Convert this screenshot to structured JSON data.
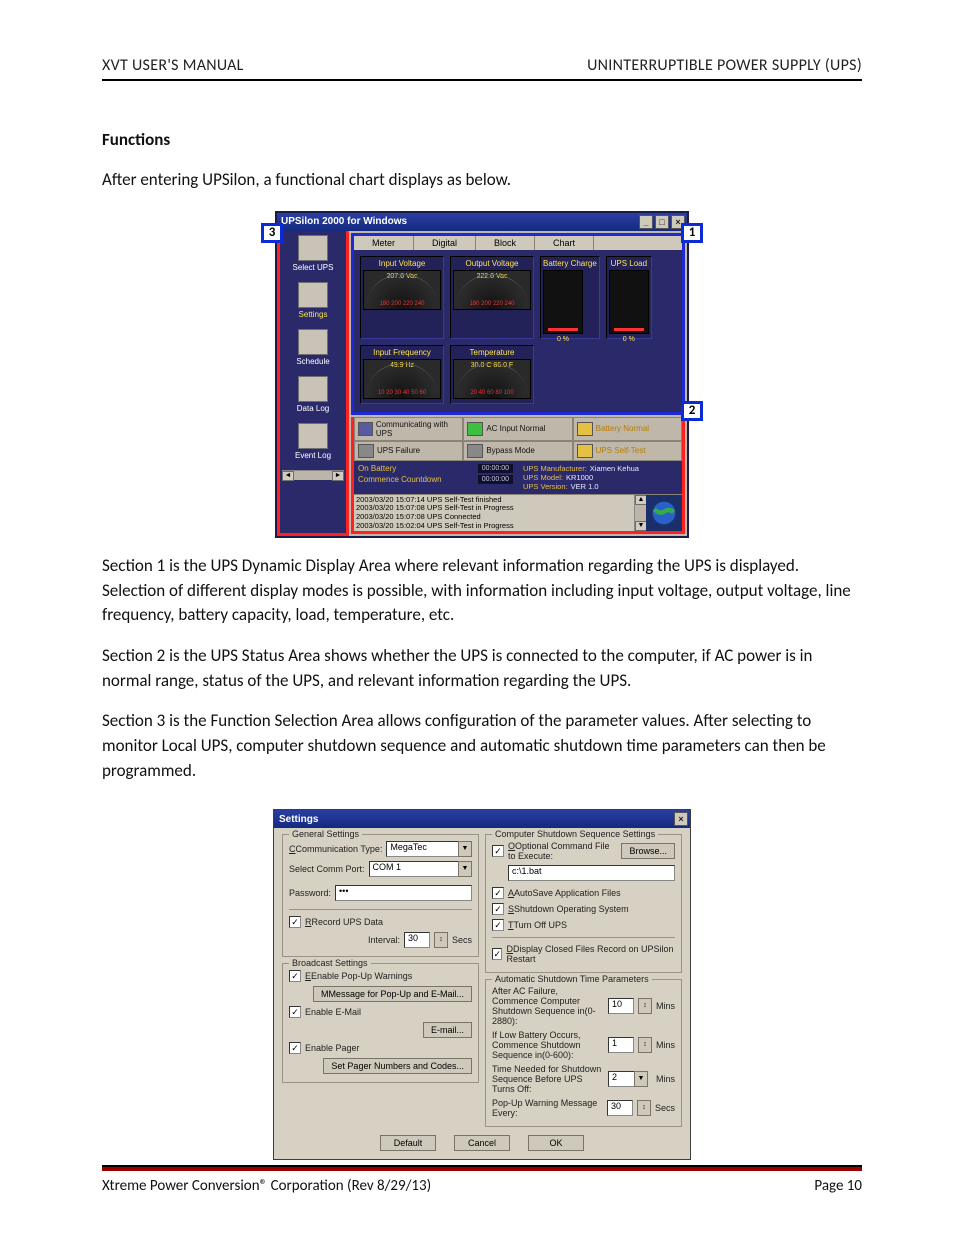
{
  "header": {
    "left": "XVT USER'S MANUAL",
    "right": "UNINTERRUPTIBLE POWER SUPPLY (UPS)"
  },
  "section_title": "Functions",
  "paras": {
    "p0": "After entering UPSilon, a functional chart displays as below.",
    "p1": "Section 1 is the UPS Dynamic Display Area where relevant information regarding the UPS is displayed. Selection of different display modes is possible, with information including input voltage, output voltage, line frequency, battery capacity, load, temperature, etc.",
    "p2": "Section 2 is the UPS Status Area shows whether the UPS is connected to the computer, if AC power is in normal range, status of the UPS, and relevant information regarding the UPS.",
    "p3": "Section 3 is the Function Selection Area allows configuration of the parameter values.  After selecting to monitor Local UPS, computer shutdown sequence and automatic shutdown time parameters can then be programmed."
  },
  "tags": {
    "t1": "1",
    "t2": "2",
    "t3": "3"
  },
  "upsilon": {
    "title": "UPSilon 2000 for Windows",
    "winbtns": {
      "min": "_",
      "max": "□",
      "close": "×"
    },
    "sidebar": {
      "items": [
        {
          "label": "Select UPS",
          "hi": false
        },
        {
          "label": "Settings",
          "hi": true
        },
        {
          "label": "Schedule",
          "hi": false
        },
        {
          "label": "Data Log",
          "hi": false
        },
        {
          "label": "Event Log",
          "hi": false
        }
      ],
      "arrows": {
        "left": "◄",
        "right": "►"
      }
    },
    "tabs": [
      "Meter",
      "Digital",
      "Block",
      "Chart"
    ],
    "panels": {
      "ivolt": {
        "t": "Input Voltage",
        "v": "207.6 Vac",
        "ticks": "180 200 220 240"
      },
      "ovolt": {
        "t": "Output Voltage",
        "v": "222.6 Vac",
        "ticks": "180 200 220 240"
      },
      "batt": {
        "t": "Battery Charge",
        "pct": "0 %"
      },
      "load": {
        "t": "UPS Load",
        "pct": "0 %"
      },
      "ifreq": {
        "t": "Input Frequency",
        "v": "49.9 Hz",
        "ticks": "10 20 30 40 50 60"
      },
      "temp": {
        "t": "Temperature",
        "v": "30.0 C   86.0 F",
        "ticks": "20 40 60 80 100"
      }
    },
    "status": {
      "r1": [
        {
          "t": "Communicating with UPS"
        },
        {
          "t": "AC Input Normal"
        },
        {
          "t": "Battery Normal",
          "y": true
        }
      ],
      "r2": [
        {
          "t": "UPS Failure"
        },
        {
          "t": "Bypass Mode"
        },
        {
          "t": "UPS Self-Test",
          "y": true
        }
      ],
      "count": {
        "l1": "On Battery",
        "v1": "00:00:00",
        "l2": "Commence Countdown",
        "v2": "00:00:00"
      },
      "mfg": {
        "a": "UPS Manufacturer:",
        "av": "Xiamen Kehua",
        "b": "UPS Model:",
        "bv": "KR1000",
        "c": "UPS Version:",
        "cv": "VER 1.0"
      },
      "logs": [
        "2003/03/20 15:07:14  UPS Self-Test finished",
        "2003/03/20 15:07:08  UPS Self-Test in Progress",
        "2003/03/20 15:07:08  UPS Connected",
        "2003/03/20 15:02:04  UPS Self-Test in Progress"
      ]
    }
  },
  "settings": {
    "title": "Settings",
    "close": "×",
    "arrow": "▼",
    "spin": "↕",
    "general": {
      "t": "General Settings",
      "comm_type_l": "Communication Type:",
      "comm_type_v": "MegaTec",
      "port_l": "Select Comm Port:",
      "port_v": "COM 1",
      "pw_l": "Password:",
      "pw_v": "•••",
      "rec_l": "Record UPS Data",
      "int_l": "Interval:",
      "int_v": "30",
      "int_u": "Secs"
    },
    "broadcast": {
      "t": "Broadcast Settings",
      "popup": "Enable Pop-Up Warnings",
      "msg_btn": "Message for Pop-Up and E-Mail...",
      "email": "Enable E-Mail",
      "email_btn": "E-mail...",
      "pager": "Enable Pager",
      "pager_btn": "Set Pager Numbers and Codes..."
    },
    "shutdown": {
      "t": "Computer Shutdown Sequence Settings",
      "optfile": "Optional Command File to Execute:",
      "browse": "Browse...",
      "file": "c:\\1.bat",
      "autosave": "AutoSave Application Files",
      "shutos": "Shutdown Operating System",
      "turnoff": "Turn Off UPS",
      "dcf": "Display Closed Files Record on UPSilon Restart"
    },
    "auto": {
      "t": "Automatic Shutdown Time Parameters",
      "l1": "After AC Failure, Commence Computer Shutdown Sequence in(0-2880):",
      "v1": "10",
      "u1": "Mins",
      "l2": "If Low Battery Occurs, Commence Shutdown Sequence in(0-600):",
      "v2": "1",
      "u2": "Mins",
      "l3": "Time Needed for Shutdown Sequence Before UPS Turns Off:",
      "v3": "2",
      "u3": "Mins",
      "l4": "Pop-Up Warning Message Every:",
      "v4": "30",
      "u4": "Secs"
    },
    "btns": {
      "def": "Default",
      "cancel": "Cancel",
      "ok": "OK"
    }
  },
  "footer": {
    "left": "Xtreme Power Conversion® Corporation (Rev 8/29/13)",
    "right": "Page 10"
  }
}
